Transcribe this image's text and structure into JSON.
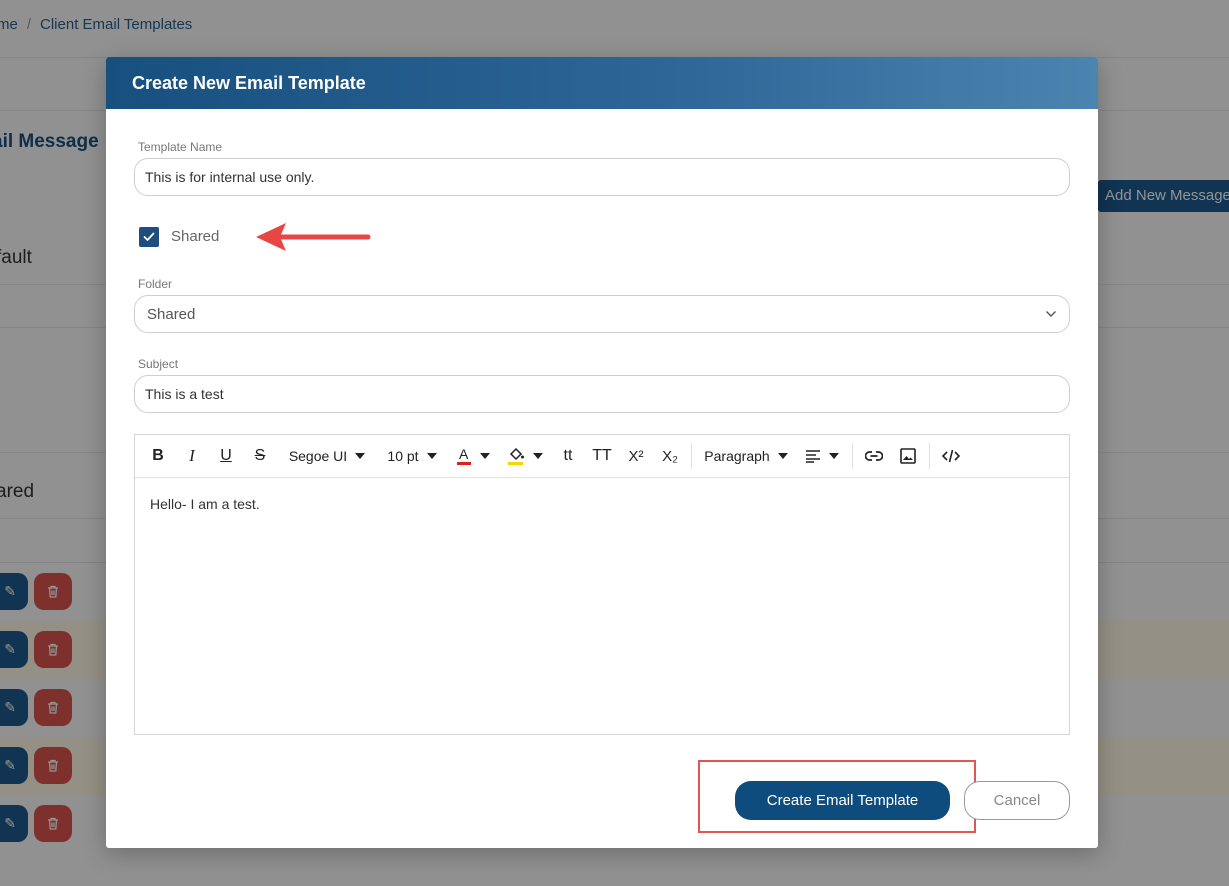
{
  "background": {
    "breadcrumb": {
      "home": "me",
      "current": "Client Email Templates"
    },
    "heading": "ail Message",
    "add_button": "Add New Message",
    "sections": {
      "default": "fault",
      "shared": "ared"
    }
  },
  "modal": {
    "title": "Create New Email Template",
    "template_name": {
      "label": "Template Name",
      "value": "This is for internal use only."
    },
    "shared_checkbox": {
      "label": "Shared",
      "checked": true
    },
    "folder": {
      "label": "Folder",
      "value": "Shared"
    },
    "subject": {
      "label": "Subject",
      "value": "This is a test"
    },
    "editor": {
      "font_family": "Segoe UI",
      "font_size": "10 pt",
      "block_format": "Paragraph",
      "font_color": "#e02020",
      "highlight_color": "#f5d800",
      "body": "Hello- I am a test."
    },
    "create_button": "Create Email Template",
    "cancel_button": "Cancel"
  },
  "colors": {
    "primary": "#0f4c7e",
    "danger": "#d9534f",
    "annotation": "#e84545"
  }
}
